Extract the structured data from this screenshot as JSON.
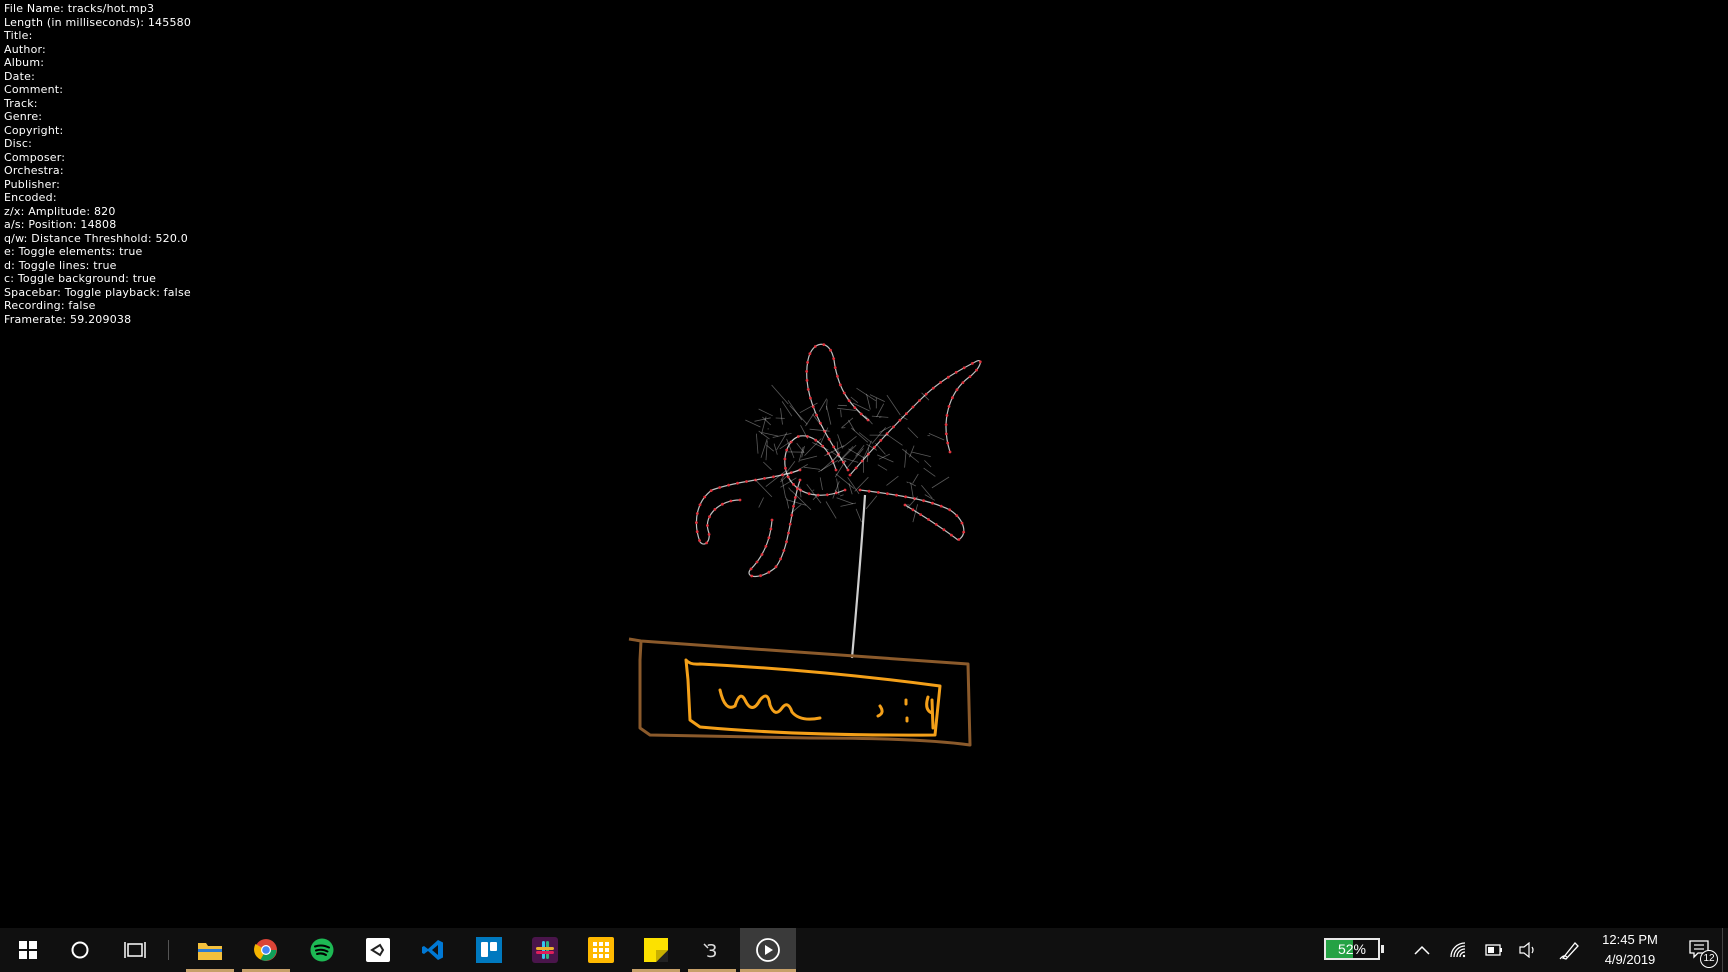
{
  "info_lines": [
    "File Name: tracks/hot.mp3",
    "Length (in milliseconds): 145580",
    "Title:",
    "Author:",
    "Album:",
    "Date:",
    "Comment:",
    "Track:",
    "Genre:",
    "Copyright:",
    "Disc:",
    "Composer:",
    "Orchestra:",
    "Publisher:",
    "Encoded:",
    "z/x: Amplitude: 820",
    "a/s: Position: 14808",
    "q/w: Distance Threshhold: 520.0",
    "e: Toggle elements: true",
    "d: Toggle lines: true",
    "c: Toggle background: true",
    "Spacebar: Toggle playback: false",
    "Recording: false",
    "Framerate: 59.209038"
  ],
  "taskbar": {
    "apps": [
      {
        "name": "start-button",
        "icon": "windows-icon"
      },
      {
        "name": "cortana-button",
        "icon": "cortana-circle-icon"
      },
      {
        "name": "task-view-button",
        "icon": "task-view-icon"
      },
      {
        "name": "file-explorer-button",
        "icon": "folder-icon",
        "active": true
      },
      {
        "name": "chrome-button",
        "icon": "chrome-icon",
        "active": true
      },
      {
        "name": "spotify-button",
        "icon": "spotify-icon"
      },
      {
        "name": "unity-button",
        "icon": "unity-icon"
      },
      {
        "name": "vscode-button",
        "icon": "vscode-icon"
      },
      {
        "name": "trello-button",
        "icon": "trello-icon"
      },
      {
        "name": "slack-button",
        "icon": "slack-icon"
      },
      {
        "name": "app-grid-button",
        "icon": "grid-icon"
      },
      {
        "name": "sticky-notes-button",
        "icon": "sticky-notes-icon",
        "active": true
      },
      {
        "name": "processing-button",
        "icon": "processing-icon",
        "active": true
      },
      {
        "name": "media-player-button",
        "icon": "play-icon",
        "focused": true
      }
    ],
    "battery_percent": "52%",
    "battery_level": 0.52,
    "time": "12:45 PM",
    "date": "4/9/2019",
    "notification_count": "12"
  },
  "colors": {
    "background": "#000000",
    "taskbar": "#101010",
    "accent_underline": "#c7a069",
    "flower_nodes": "#e0323c",
    "pot_outer": "#8b5a2b",
    "pot_inner": "#f4a019",
    "battery_fill": "#25a244"
  }
}
